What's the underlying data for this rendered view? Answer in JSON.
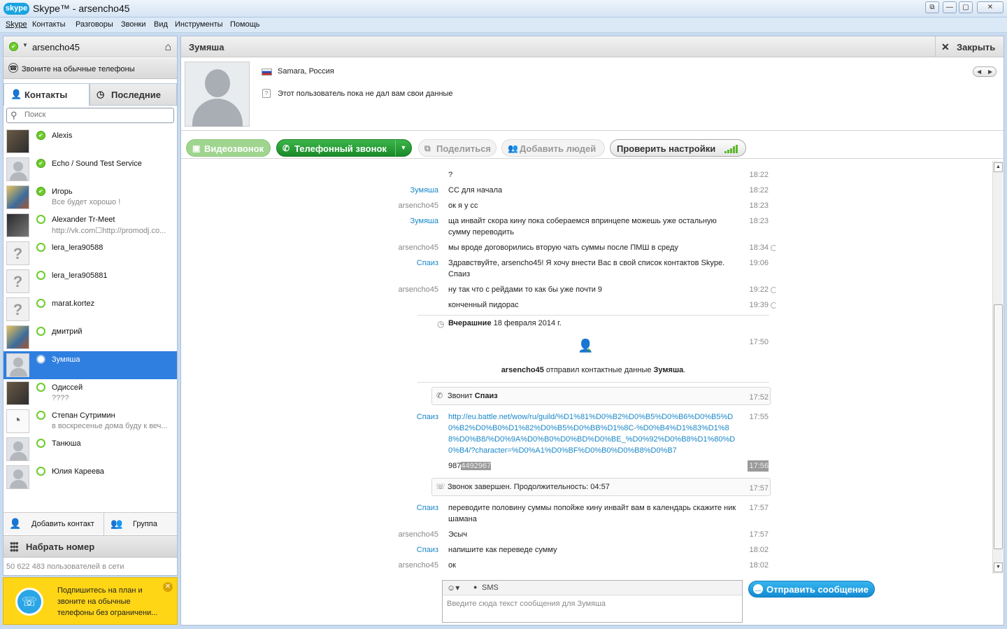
{
  "window": {
    "logo": "skype",
    "title": "Skype™ - arsencho45",
    "controls": [
      "restore-small-icon",
      "minimize-icon",
      "maximize-icon",
      "close-icon"
    ]
  },
  "menu": [
    "Skype",
    "Контакты",
    "Разговоры",
    "Звонки",
    "Вид",
    "Инструменты",
    "Помощь"
  ],
  "me": {
    "name": "arsencho45",
    "status": "online"
  },
  "call_phones": "Звоните на обычные телефоны",
  "tabs": {
    "contacts": "Контакты",
    "recent": "Последние"
  },
  "search": {
    "placeholder": "Поиск"
  },
  "contacts": [
    {
      "name": "Alexis",
      "mood": "",
      "status": "online",
      "avatar": "photo"
    },
    {
      "name": "Echo / Sound Test Service",
      "mood": "",
      "status": "online",
      "avatar": "gray"
    },
    {
      "name": "Игорь",
      "mood": "Все будет хорошо !",
      "status": "online",
      "avatar": "photo2"
    },
    {
      "name": "Alexander Tr-Meet",
      "mood": "http://vk.com☐http://promodj.co...",
      "status": "offline",
      "avatar": "photo3"
    },
    {
      "name": "lera_lera90588",
      "mood": "",
      "status": "offline",
      "avatar": "q"
    },
    {
      "name": "lera_lera905881",
      "mood": "",
      "status": "offline",
      "avatar": "q"
    },
    {
      "name": "marat.kortez",
      "mood": "",
      "status": "offline",
      "avatar": "q"
    },
    {
      "name": "дмитрий",
      "mood": "",
      "status": "offline",
      "avatar": "photo2"
    },
    {
      "name": "Зумяша",
      "mood": "",
      "status": "unknown",
      "avatar": "gray",
      "selected": true
    },
    {
      "name": "Одиссей",
      "mood": "????",
      "status": "offline",
      "avatar": "photo"
    },
    {
      "name": "Степан Сутримин",
      "mood": "в воскресенье дома буду к веч...",
      "status": "offline",
      "avatar": "sketch"
    },
    {
      "name": "Танюша",
      "mood": "",
      "status": "offline",
      "avatar": "gray"
    },
    {
      "name": "Юлия Кареева",
      "mood": "",
      "status": "offline",
      "avatar": "gray"
    }
  ],
  "left_buttons": {
    "add_contact": "Добавить контакт",
    "group": "Группа"
  },
  "dial": "Набрать номер",
  "user_count": "50 622 483 пользователей в сети",
  "promo": "Подпишитесь на план и звоните на обычные телефоны без ограничени...",
  "chat": {
    "title": "Зумяша",
    "close": "Закрыть",
    "location": "Samara, Россия",
    "info": "Этот пользователь пока не дал вам свои данные",
    "buttons": {
      "video": "Видеозвонок",
      "phone": "Телефонный звонок",
      "share": "Поделиться",
      "add_people": "Добавить людей",
      "check": "Проверить настройки"
    },
    "messages": [
      {
        "sender": "",
        "text": "?",
        "time": "18:22"
      },
      {
        "sender": "Зумяша",
        "text": "СС для начала",
        "time": "18:22",
        "blue": true
      },
      {
        "sender": "arsencho45",
        "text": "ок я у сс",
        "time": "18:23"
      },
      {
        "sender": "Зумяша",
        "text": "ща инвайт скора кину пока собераемся впринцепе можешь уже остальную сумму переводить",
        "time": "18:23",
        "blue": true
      },
      {
        "sender": "arsencho45",
        "text": "мы вроде договорились вторую чать суммы после ПМШ в среду",
        "time": "18:34",
        "pending": true
      },
      {
        "sender": "Спаиз",
        "text": "Здравствуйте, arsencho45! Я хочу внести Вас в свой список контактов Skype. Спаиз",
        "time": "19:06",
        "blue": true
      },
      {
        "sender": "arsencho45",
        "text": "ну так что с рейдами то как бы уже почти 9",
        "time": "19:22",
        "pending": true
      },
      {
        "sender": "",
        "text": "конченный пидорас",
        "time": "19:39",
        "pending": true
      }
    ],
    "day_separator": {
      "bold": "Вчерашние",
      "rest": " 18 февраля 2014 г."
    },
    "contact_event": {
      "time": "17:50",
      "user": "arsencho45",
      "mid": " отправил контактные данные ",
      "target": "Зумяша",
      "end": "."
    },
    "call_start": {
      "label": "Звонит ",
      "who": "Спаиз",
      "time": "17:52"
    },
    "link_msg": {
      "sender": "Спаиз",
      "url": "http://eu.battle.net/wow/ru/guild/%D1%81%D0%B2%D0%B5%D0%B6%D0%B5%D0%B2%D0%B0%D1%82%D0%B5%D0%BB%D1%8C-%D0%B4%D1%83%D1%88%D0%B8/%D0%9A%D0%B0%D0%BD%D0%BE_%D0%92%D0%B8%D1%80%D0%B4/?character=%D0%A1%D0%BF%D0%B0%D0%B8%D0%B7",
      "time": "17:55"
    },
    "number_msg": {
      "prefix": "987",
      "selected": "4492967",
      "time": "17:56"
    },
    "call_end": {
      "text": "Звонок завершен. Продолжительность: 04:57",
      "time": "17:57"
    },
    "messages2": [
      {
        "sender": "Спаиз",
        "text": "переводите половину суммы попойже кину инвайт вам в календарь скажите ник шамана",
        "time": "17:57",
        "blue": true
      },
      {
        "sender": "arsencho45",
        "text": "Эсыч",
        "time": "17:57"
      },
      {
        "sender": "Спаиз",
        "text": "напишите как переведе сумму",
        "time": "18:02",
        "blue": true
      },
      {
        "sender": "arsencho45",
        "text": "ок",
        "time": "18:02"
      }
    ],
    "compose": {
      "sms": "SMS",
      "placeholder": "Введите сюда текст сообщения для Зумяша"
    },
    "send": "Отправить сообщение"
  },
  "colors": {
    "online": "#6bcc2a",
    "selection": "#2f7fe0",
    "link": "#1a87c8",
    "call_green": "#1b8a2a",
    "send_blue": "#128ad2",
    "promo_yellow": "#ffd616"
  }
}
